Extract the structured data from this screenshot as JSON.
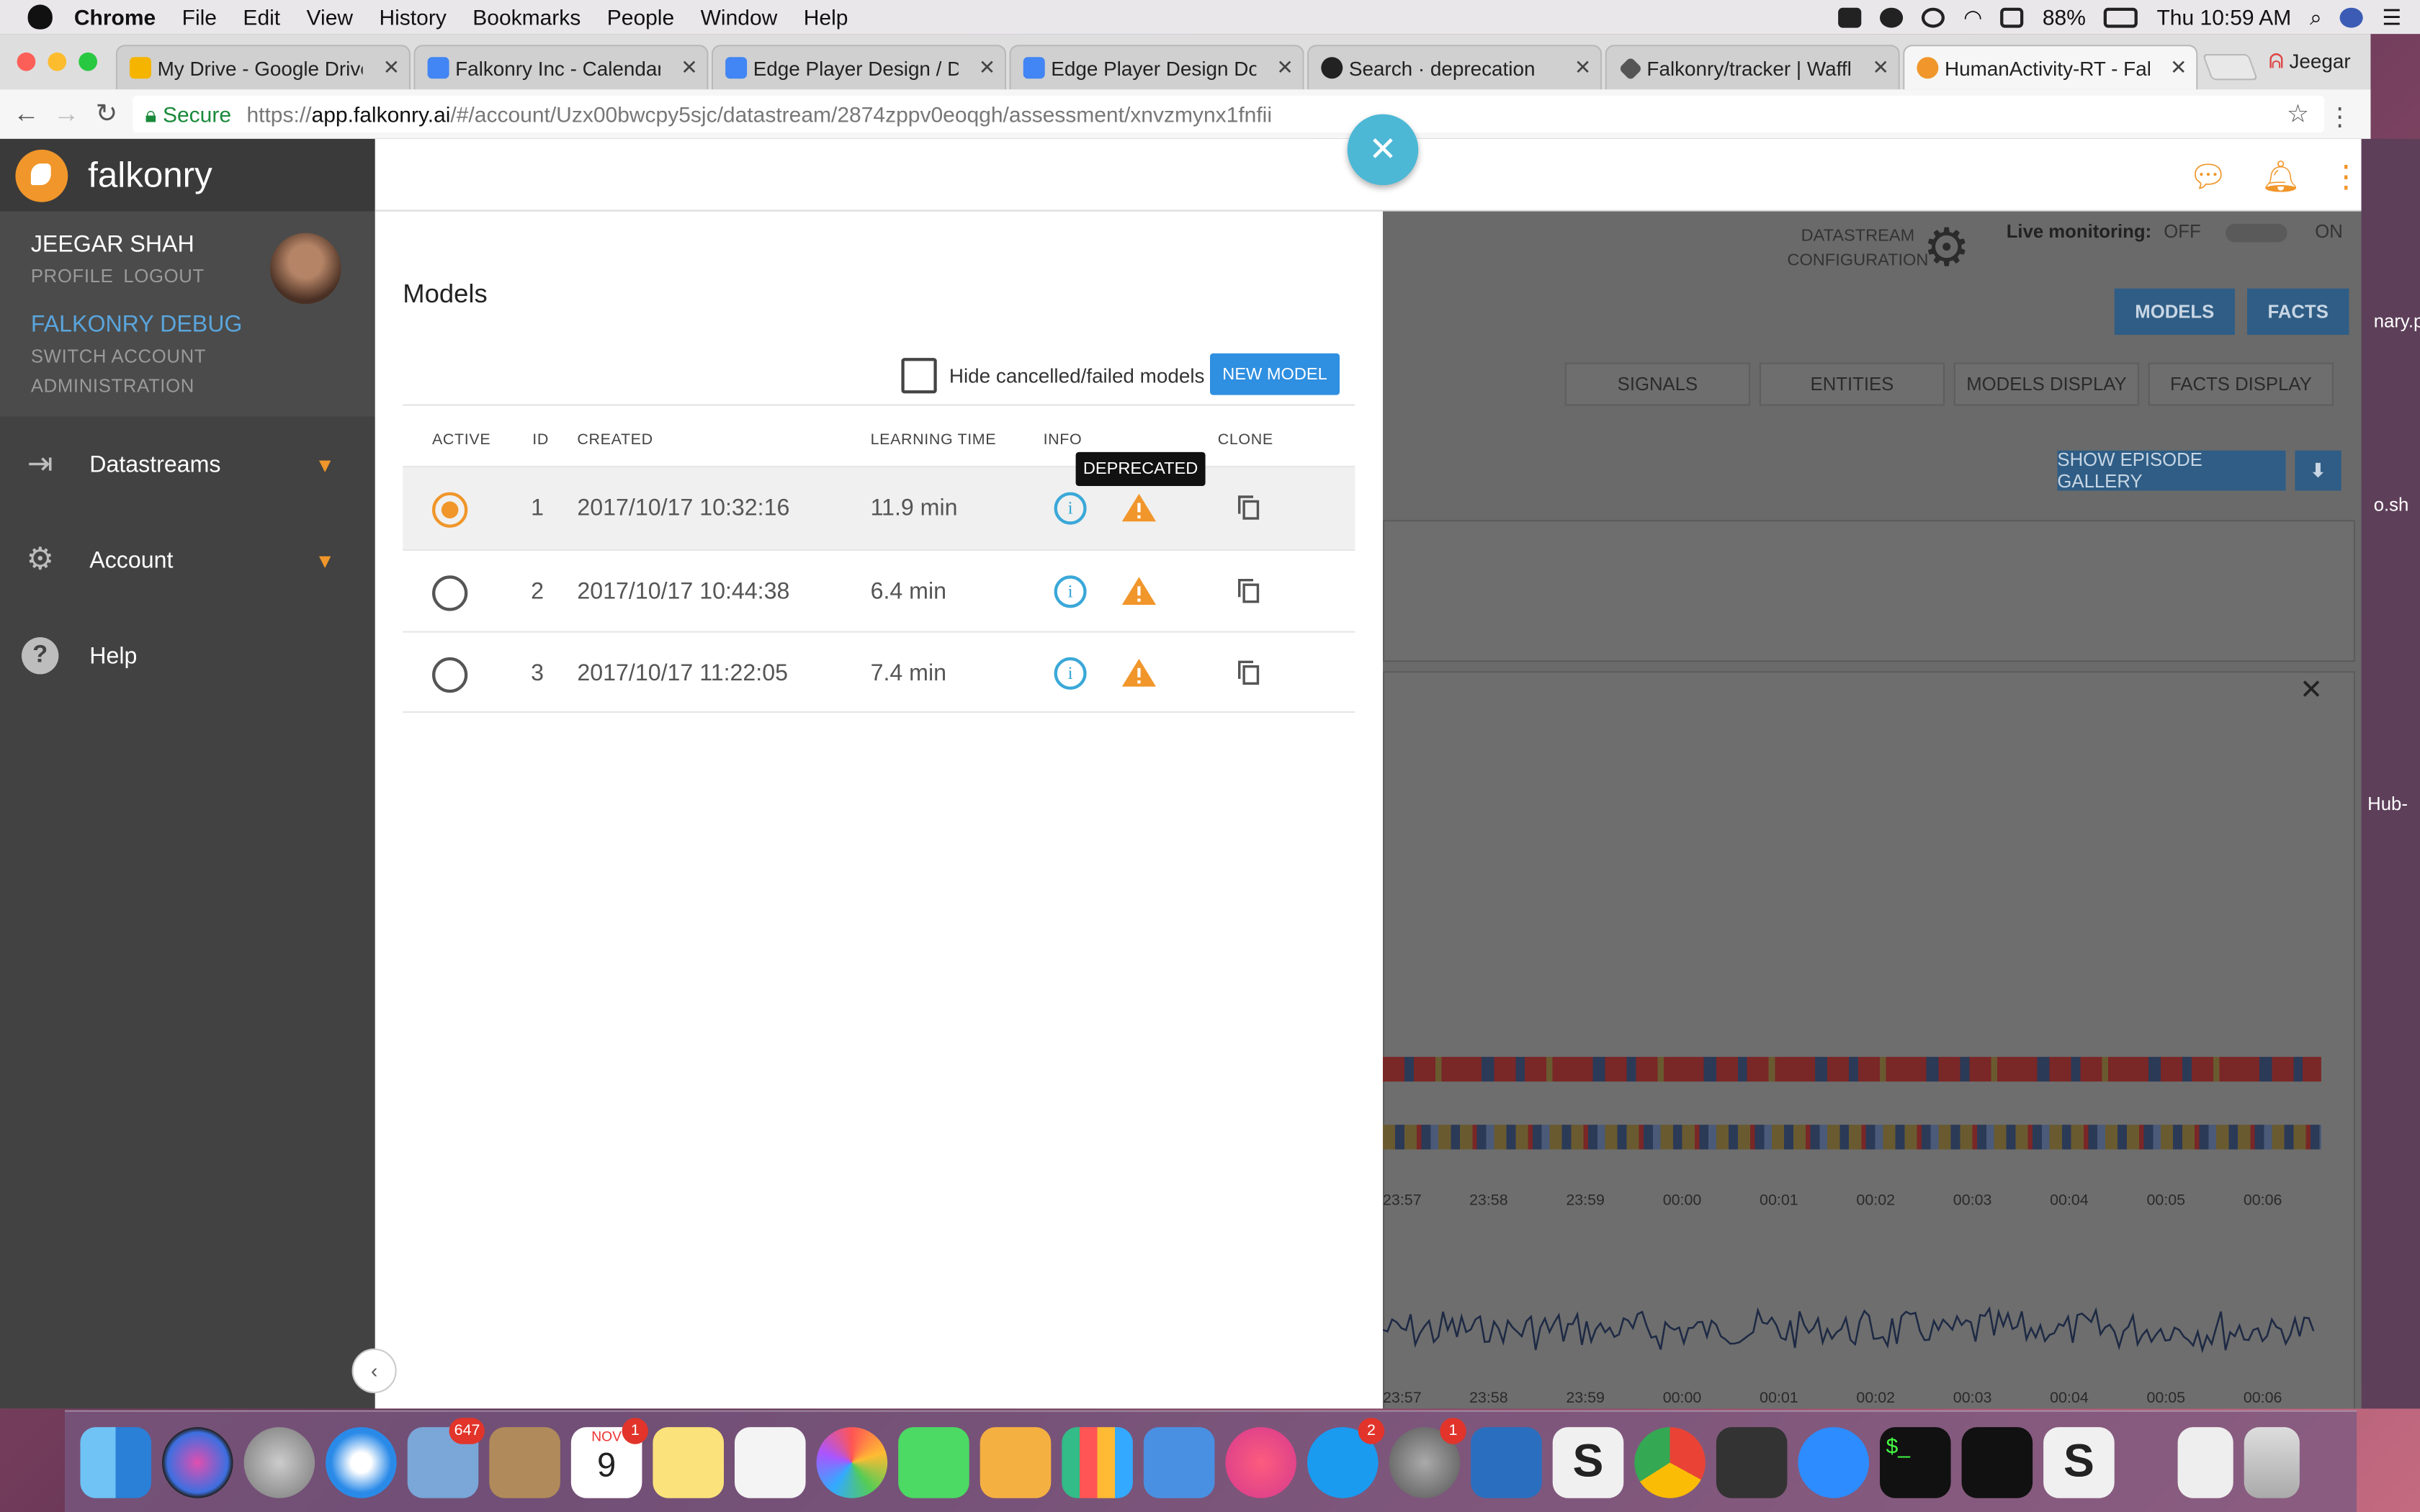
{
  "menubar": {
    "app": "Chrome",
    "items": [
      "File",
      "Edit",
      "View",
      "History",
      "Bookmarks",
      "People",
      "Window",
      "Help"
    ],
    "battery": "88%",
    "clock": "Thu 10:59 AM"
  },
  "browser": {
    "tabs": [
      {
        "title": "My Drive - Google Drive",
        "color": "#f4b400"
      },
      {
        "title": "Falkonry Inc - Calendar - W",
        "color": "#4285f4"
      },
      {
        "title": "Edge Player Design / Deplo",
        "color": "#4285f4"
      },
      {
        "title": "Edge Player Design Docum",
        "color": "#4285f4"
      },
      {
        "title": "Search · deprecation",
        "color": "#222222"
      },
      {
        "title": "Falkonry/tracker | Waffle.io",
        "color": "#555555"
      },
      {
        "title": "HumanActivity-RT - Falkon",
        "color": "#f0962a"
      }
    ],
    "profile": "Jeegar",
    "url_secure": "Secure",
    "url_scheme": "https://",
    "url_host": "app.falkonry.ai",
    "url_path": "/#/account/Uzx00bwcpy5sjc/datastream/2874zppv0eoqgh/assessment/xnvzmynx1fnfii"
  },
  "sidebar": {
    "brand": "falkonry",
    "user_name": "JEEGAR SHAH",
    "profile": "PROFILE",
    "logout": "LOGOUT",
    "account_name": "FALKONRY DEBUG",
    "switch_account": "SWITCH ACCOUNT",
    "administration": "ADMINISTRATION",
    "nav": [
      {
        "label": "Datastreams",
        "icon": "datastreams-icon"
      },
      {
        "label": "Account",
        "icon": "gear-icon"
      },
      {
        "label": "Help",
        "icon": "help-icon"
      }
    ]
  },
  "background_page": {
    "config_label_1": "DATASTREAM",
    "config_label_2": "CONFIGURATION",
    "live_label": "Live monitoring:",
    "live_off": "OFF",
    "live_on": "ON",
    "models_btn": "MODELS",
    "facts_btn": "FACTS",
    "tabs": [
      "SIGNALS",
      "ENTITIES",
      "MODELS DISPLAY",
      "FACTS DISPLAY"
    ],
    "gallery_btn": "SHOW EPISODE GALLERY",
    "ticks": [
      "23:57",
      "23:58",
      "23:59",
      "00:00",
      "00:01",
      "00:02",
      "00:03",
      "00:04",
      "00:05",
      "00:06"
    ],
    "outside_text": [
      "nary.p",
      "o.sh",
      "Hub-"
    ]
  },
  "modal": {
    "title": "Models",
    "hide_label": "Hide cancelled/failed models",
    "hide_checked": false,
    "new_model": "NEW MODEL",
    "columns": {
      "active": "ACTIVE",
      "id": "ID",
      "created": "CREATED",
      "learning": "LEARNING TIME",
      "info": "INFO",
      "clone": "CLONE"
    },
    "rows": [
      {
        "active": true,
        "id": "1",
        "created": "2017/10/17 10:32:16",
        "learning": "11.9 min"
      },
      {
        "active": false,
        "id": "2",
        "created": "2017/10/17 10:44:38",
        "learning": "6.4 min"
      },
      {
        "active": false,
        "id": "3",
        "created": "2017/10/17 11:22:05",
        "learning": "7.4 min"
      }
    ],
    "tooltip": "DEPRECATED"
  },
  "dock": {
    "badges": {
      "mail": "647",
      "calendar": "1",
      "appstore": "2",
      "prefs": "1"
    },
    "calendar_month": "NOV",
    "calendar_day": "9"
  },
  "colors": {
    "accent": "#f0962a",
    "primary": "#2f8fe0",
    "info": "#3aa8d8",
    "fab": "#4cb8d6"
  }
}
